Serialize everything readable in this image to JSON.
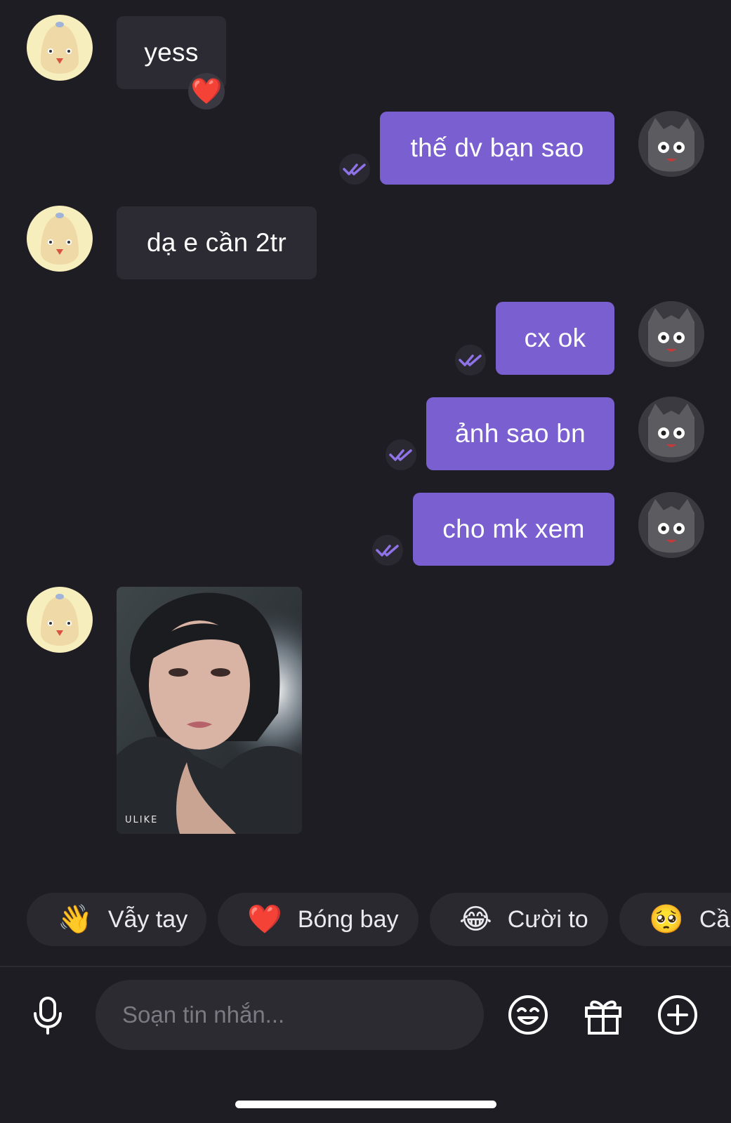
{
  "messages": [
    {
      "text": "yess",
      "reaction": "❤️"
    },
    {
      "text": "thế dv bạn sao"
    },
    {
      "text": "dạ e cần 2tr"
    },
    {
      "text": "cx ok"
    },
    {
      "text": "ảnh sao bn"
    },
    {
      "text": "cho mk xem"
    }
  ],
  "photo": {
    "watermark": "ULIKE"
  },
  "quick_replies": [
    {
      "emoji": "👋",
      "label": "Vẫy tay"
    },
    {
      "emoji": "❤️",
      "label": "Bóng bay"
    },
    {
      "emoji": "😂",
      "label": "Cười to"
    },
    {
      "emoji": "🥺",
      "label": "Cầu"
    }
  ],
  "composer": {
    "placeholder": "Soạn tin nhắn..."
  },
  "colors": {
    "background": "#1e1d23",
    "outgoing_bubble": "#7a5fd0",
    "incoming_bubble": "#2c2b33"
  },
  "icons": [
    "microphone-icon",
    "emoji-icon",
    "gift-icon",
    "plus-circle-icon",
    "double-check-icon"
  ]
}
